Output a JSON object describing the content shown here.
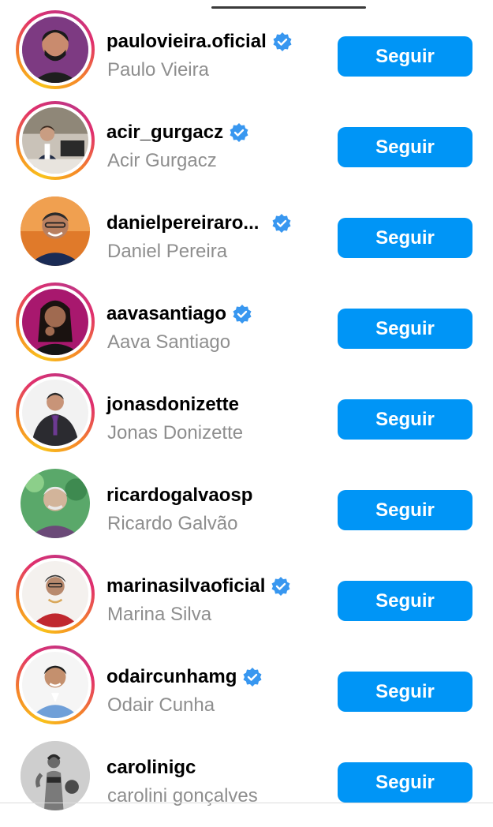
{
  "accounts": [
    {
      "username": "paulovieira.oficial",
      "full_name": "Paulo Vieira",
      "verified": true,
      "story_ring": true,
      "button": "Seguir"
    },
    {
      "username": "acir_gurgacz",
      "full_name": "Acir Gurgacz",
      "verified": true,
      "story_ring": true,
      "button": "Seguir"
    },
    {
      "username": "danielpereiraro...",
      "full_name": "Daniel Pereira",
      "verified": true,
      "story_ring": false,
      "button": "Seguir"
    },
    {
      "username": "aavasantiago",
      "full_name": "Aava Santiago",
      "verified": true,
      "story_ring": true,
      "button": "Seguir"
    },
    {
      "username": "jonasdonizette",
      "full_name": "Jonas Donizette",
      "verified": false,
      "story_ring": true,
      "button": "Seguir"
    },
    {
      "username": "ricardogalvaosp",
      "full_name": "Ricardo Galvão",
      "verified": false,
      "story_ring": false,
      "button": "Seguir"
    },
    {
      "username": "marinasilvaoficial",
      "full_name": "Marina Silva",
      "verified": true,
      "story_ring": true,
      "button": "Seguir"
    },
    {
      "username": "odaircunhamg",
      "full_name": "Odair Cunha",
      "verified": true,
      "story_ring": true,
      "button": "Seguir"
    },
    {
      "username": "carolinigc",
      "full_name": "carolini gonçalves",
      "verified": false,
      "story_ring": false,
      "button": "Seguir"
    }
  ],
  "icons": {
    "verified": "verified-badge-icon"
  },
  "colors": {
    "button": "#0095f6",
    "verified": "#3897f0",
    "secondary_text": "#8e8e8e"
  }
}
